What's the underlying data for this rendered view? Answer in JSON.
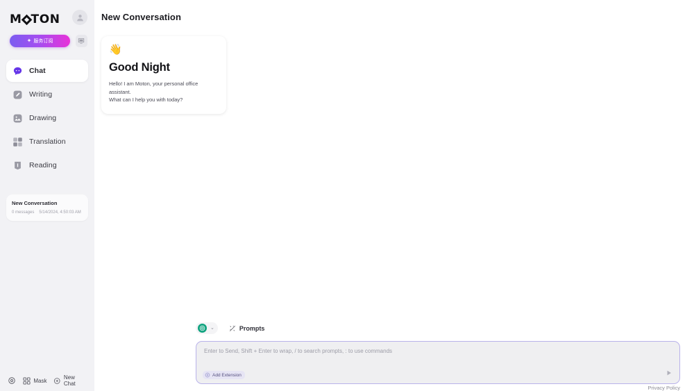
{
  "sidebar": {
    "logo_text": "M",
    "logo_text_tail": "TON",
    "avatar_icon": "user-avatar-icon",
    "subscribe": {
      "label": "服务订阅",
      "spark": "✦",
      "gradient_from": "#7b5cf0",
      "gradient_to": "#e832d8"
    },
    "screen_button_icon": "monitor-icon",
    "items": [
      {
        "label": "Chat",
        "icon": "chat-bubble-icon",
        "active": true,
        "color": "#6636e8"
      },
      {
        "label": "Writing",
        "icon": "pencil-icon",
        "active": false,
        "color": "#8e8e99"
      },
      {
        "label": "Drawing",
        "icon": "image-icon",
        "active": false,
        "color": "#8e8e99"
      },
      {
        "label": "Translation",
        "icon": "translate-grid-icon",
        "active": false,
        "color": "#8e8e99"
      },
      {
        "label": "Reading",
        "icon": "book-icon",
        "active": false,
        "color": "#8e8e99"
      }
    ],
    "history": [
      {
        "title": "New Conversation",
        "message_count": "0 messages",
        "timestamp": "5/14/2024, 4:50:03 AM"
      }
    ],
    "bottom": {
      "settings_icon": "gear-icon",
      "mask_label": "Mask",
      "mask_icon": "grid-icon",
      "new_chat_label": "New Chat",
      "new_chat_icon": "plus-circle-icon"
    }
  },
  "main": {
    "header_title": "New Conversation",
    "greeting": {
      "emoji": "👋",
      "title": "Good Night",
      "line1": "Hello! I am Moton, your personal office assistant.",
      "line2": "What can I help you with today?"
    },
    "composer": {
      "model_icon": "openai-logo-icon",
      "model_chevron": "⌄",
      "prompts_label": "Prompts",
      "prompts_icon": "magic-wand-icon",
      "input_value": "",
      "input_placeholder": "Enter to Send, Shift + Enter to wrap, / to search prompts, : to use commands",
      "add_extension_label": "Add Extension",
      "add_extension_icon": "plus-circle-icon",
      "send_icon": "send-triangle-icon"
    },
    "privacy_label": "Privacy Policy"
  }
}
